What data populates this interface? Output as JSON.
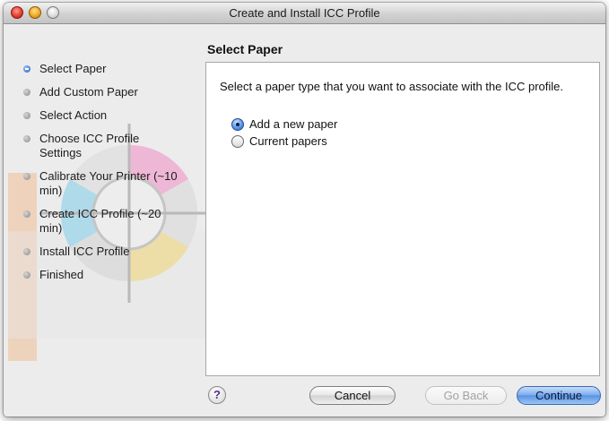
{
  "window": {
    "title": "Create and Install ICC Profile"
  },
  "sidebar": {
    "steps": [
      {
        "label": "Select Paper",
        "state": "current"
      },
      {
        "label": "Add Custom Paper",
        "state": "pending"
      },
      {
        "label": "Select Action",
        "state": "pending"
      },
      {
        "label": "Choose ICC Profile Settings",
        "state": "pending"
      },
      {
        "label": "Calibrate Your Printer (~10 min)",
        "state": "pending"
      },
      {
        "label": "Create ICC Profile (~20 min)",
        "state": "pending"
      },
      {
        "label": "Install ICC Profile",
        "state": "pending"
      },
      {
        "label": "Finished",
        "state": "pending"
      }
    ]
  },
  "main": {
    "section_title": "Select Paper",
    "instruction": "Select a paper type that you want to associate with the ICC profile.",
    "options": [
      {
        "label": "Add a new paper",
        "selected": true
      },
      {
        "label": "Current papers",
        "selected": false
      }
    ]
  },
  "footer": {
    "help_label": "?",
    "cancel_label": "Cancel",
    "back_label": "Go Back",
    "continue_label": "Continue"
  },
  "colors": {
    "accent": "#5a94e4",
    "window_bg": "#ececec"
  }
}
